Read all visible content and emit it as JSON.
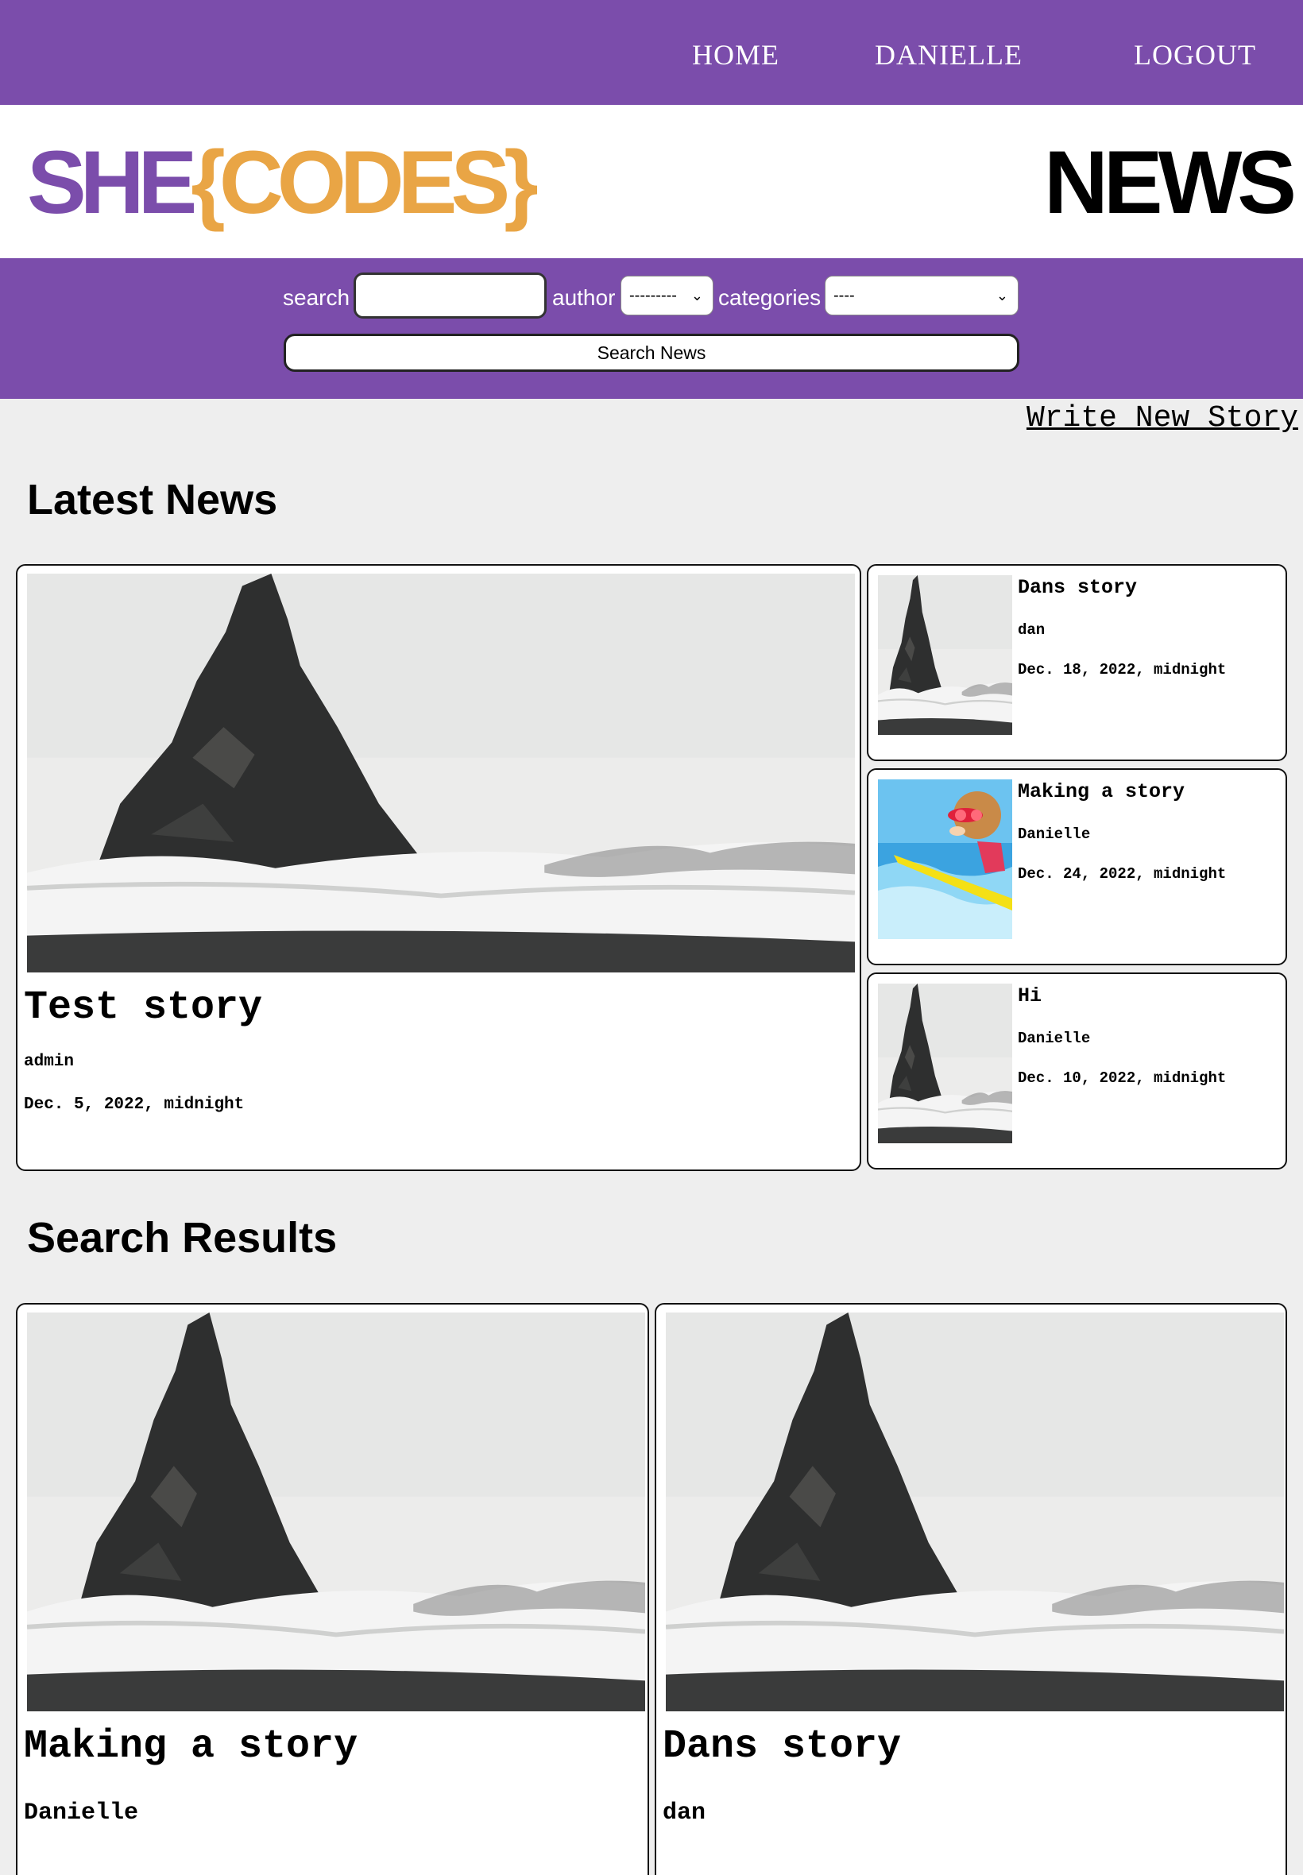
{
  "nav": {
    "home": "HOME",
    "user": "DANIELLE",
    "logout": "LOGOUT"
  },
  "brand": {
    "logo_part1": "SHE",
    "logo_part2": "{CODES}",
    "title": "NEWS"
  },
  "search": {
    "search_label": "search",
    "search_value": "",
    "author_label": "author",
    "author_selected": "---------",
    "categories_label": "categories",
    "categories_selected": "----",
    "button_label": "Search News"
  },
  "write_link": "Write New Story",
  "latest": {
    "title": "Latest News",
    "main": {
      "title": "Test story",
      "author": "admin",
      "date": "Dec. 5, 2022, midnight",
      "image": "sea-stack-photo"
    },
    "side": [
      {
        "title": "Dans story",
        "author": "dan",
        "date": "Dec. 18, 2022, midnight",
        "image": "sea-stack-photo"
      },
      {
        "title": "Making a story",
        "author": "Danielle",
        "date": "Dec. 24, 2022, midnight",
        "image": "surfing-dog-photo"
      },
      {
        "title": "Hi",
        "author": "Danielle",
        "date": "Dec. 10, 2022, midnight",
        "image": "sea-stack-photo"
      }
    ]
  },
  "results": {
    "title": "Search Results",
    "items": [
      {
        "title": "Making a story",
        "author": "Danielle",
        "image": "sea-stack-photo"
      },
      {
        "title": "Dans story",
        "author": "dan",
        "image": "sea-stack-photo"
      }
    ]
  },
  "colors": {
    "brand_purple": "#7b4dab",
    "brand_orange": "#e9a545",
    "page_bg": "#eeeeee"
  }
}
